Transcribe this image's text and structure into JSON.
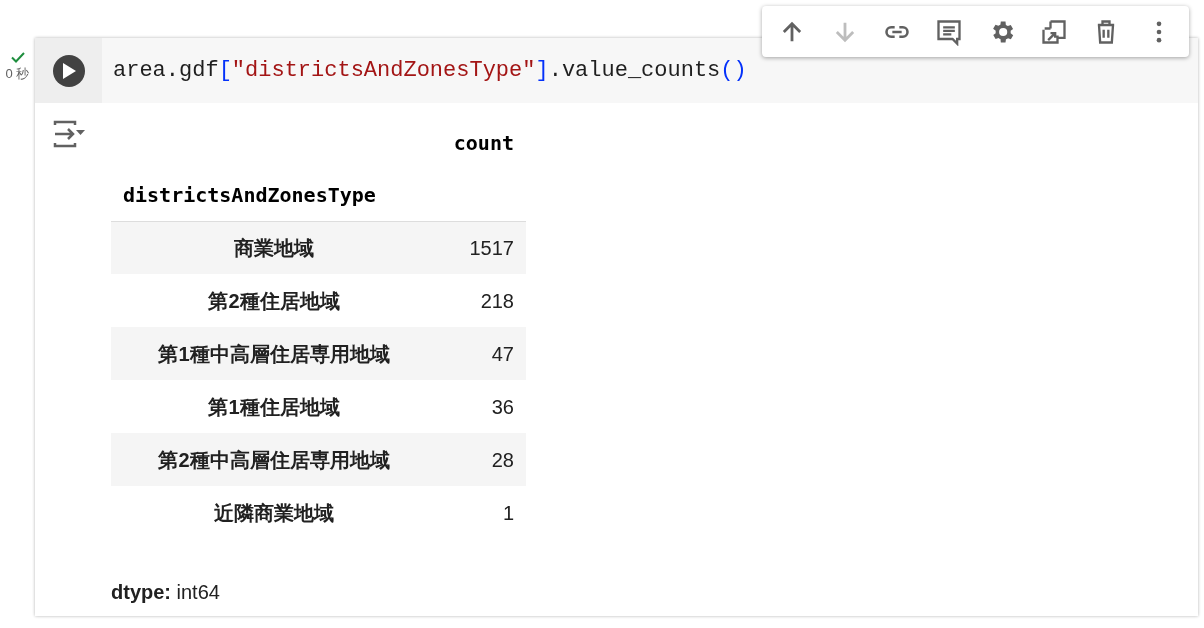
{
  "toolbar": [
    {
      "kind": "up",
      "disabled": false
    },
    {
      "kind": "down",
      "disabled": true
    },
    {
      "kind": "link",
      "disabled": false
    },
    {
      "kind": "comment",
      "disabled": false
    },
    {
      "kind": "settings",
      "disabled": false
    },
    {
      "kind": "mirror",
      "disabled": false
    },
    {
      "kind": "delete",
      "disabled": false
    },
    {
      "kind": "more",
      "disabled": false
    }
  ],
  "cell": {
    "status": {
      "ok": true,
      "time": "0 秒"
    },
    "code": [
      {
        "kind": "plain",
        "text": "area.gdf"
      },
      {
        "kind": "bracket",
        "text": "["
      },
      {
        "kind": "string",
        "text": "\"districtsAndZonesType\""
      },
      {
        "kind": "bracket",
        "text": "]"
      },
      {
        "kind": "plain",
        "text": ".value_counts"
      },
      {
        "kind": "bracket",
        "text": "()"
      }
    ],
    "output": {
      "table": {
        "columns": [
          "count"
        ],
        "index_name": "districtsAndZonesType",
        "rows": [
          {
            "index": "商業地域",
            "count": "1517"
          },
          {
            "index": "第2種住居地域",
            "count": "218"
          },
          {
            "index": "第1種中高層住居専用地域",
            "count": "47"
          },
          {
            "index": "第1種住居地域",
            "count": "36"
          },
          {
            "index": "第2種中高層住居専用地域",
            "count": "28"
          },
          {
            "index": "近隣商業地域",
            "count": "1"
          }
        ]
      },
      "dtype": "**dtype:** int64"
    }
  }
}
